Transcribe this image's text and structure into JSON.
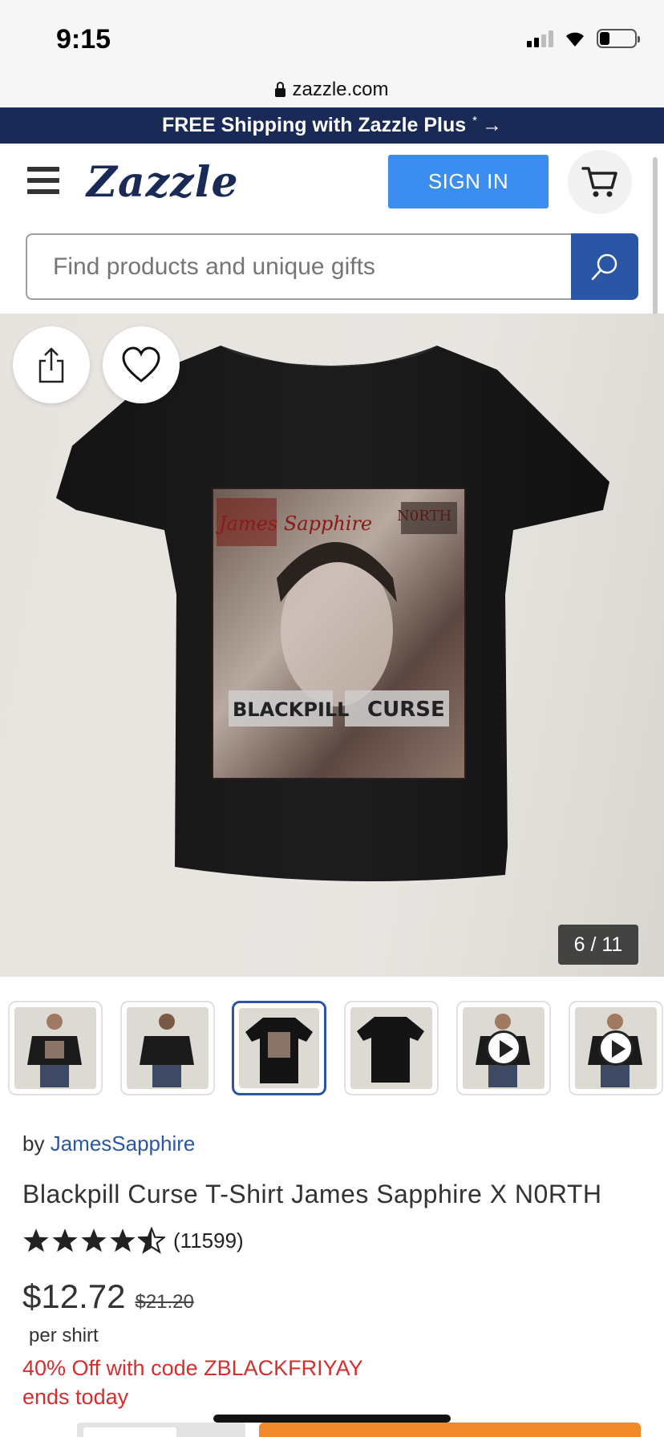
{
  "status_bar": {
    "time": "9:15"
  },
  "browser": {
    "url": "zazzle.com"
  },
  "promo_banner": {
    "text": "FREE Shipping with Zazzle Plus",
    "asterisk": "*",
    "arrow": "→"
  },
  "header": {
    "logo": "Zazzle",
    "sign_in_label": "SIGN IN",
    "search_placeholder": "Find products and unique gifts"
  },
  "gallery": {
    "counter": "6 / 11",
    "thumbnails": [
      {
        "kind": "model-front",
        "video": false,
        "selected": false
      },
      {
        "kind": "model-back",
        "video": false,
        "selected": false
      },
      {
        "kind": "shirt-front-graphic",
        "video": false,
        "selected": true
      },
      {
        "kind": "shirt-back",
        "video": false,
        "selected": false
      },
      {
        "kind": "model-video",
        "video": true,
        "selected": false
      },
      {
        "kind": "model-video",
        "video": true,
        "selected": false
      }
    ]
  },
  "product": {
    "by_prefix": "by",
    "designer": "JamesSapphire",
    "title": "Blackpill Curse T-Shirt James Sapphire X N0RTH",
    "rating": 4.5,
    "rating_count": "(11599)",
    "price": "$12.72",
    "original_price": "$21.20",
    "per_unit": "per shirt",
    "promo_line": "40% Off with code ZBLACKFRIYAY",
    "promo_expiry": "ends today"
  },
  "graphic_text": {
    "top": "James Sapphire",
    "top_right": "N0RTH",
    "bottom_left": "BLACKPILL",
    "bottom_right": "CURSE"
  },
  "colors": {
    "brand_navy": "#182a55",
    "sign_in_blue": "#3b8ef0",
    "search_blue": "#2b56a6",
    "link_blue": "#2b56a6",
    "promo_red": "#d32f2f",
    "cta_orange": "#f08a2b"
  },
  "icons": [
    "lock-icon",
    "hamburger-icon",
    "cart-icon",
    "search-icon",
    "share-icon",
    "heart-icon",
    "star-icon",
    "play-icon"
  ]
}
